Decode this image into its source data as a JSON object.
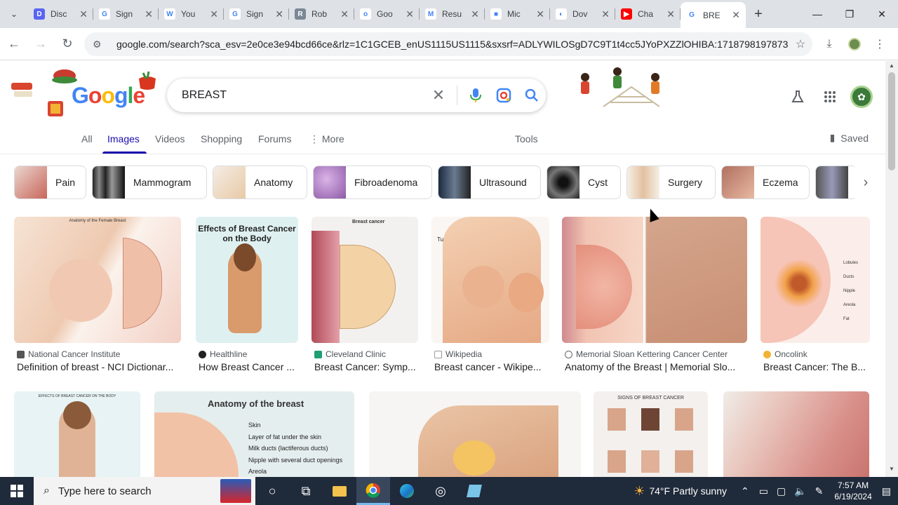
{
  "browser": {
    "tabs": [
      {
        "title": "Disc",
        "color": "#5865f2",
        "glyph": "D"
      },
      {
        "title": "Sign",
        "color": "#ffffff",
        "glyph": "G"
      },
      {
        "title": "You",
        "color": "#ffffff",
        "glyph": "W"
      },
      {
        "title": "Sign",
        "color": "#ffffff",
        "glyph": "G"
      },
      {
        "title": "Rob",
        "color": "#7a8796",
        "glyph": "R"
      },
      {
        "title": "Goo",
        "color": "#ffffff",
        "glyph": "o"
      },
      {
        "title": "Resu",
        "color": "#ffffff",
        "glyph": "M"
      },
      {
        "title": "Mic",
        "color": "#ffffff",
        "glyph": "■"
      },
      {
        "title": "Dov",
        "color": "#ffffff",
        "glyph": "◐"
      },
      {
        "title": "Cha",
        "color": "#ff0000",
        "glyph": "▶"
      },
      {
        "title": "BRE",
        "color": "#ffffff",
        "glyph": "G"
      }
    ],
    "url": "google.com/search?sca_esv=2e0ce3e94bcd66ce&rlz=1C1GCEB_enUS1115US1115&sxsrf=ADLYWILOSgD7C9T1t4cc5JYoPXZZlOHIBA:1718798197873&q=B..."
  },
  "search": {
    "query": "BREAST",
    "tabs": [
      "All",
      "Images",
      "Videos",
      "Shopping",
      "Forums",
      "More"
    ],
    "tools_label": "Tools",
    "saved_label": "Saved"
  },
  "chips": [
    "Pain",
    "Mammogram",
    "Anatomy",
    "Fibroadenoma",
    "Ultrasound",
    "Cyst",
    "Surgery",
    "Eczema"
  ],
  "results_row1": [
    {
      "source": "National Cancer Institute",
      "title": "Definition of breast - NCI Dictionar...",
      "img_caption": "Anatomy of the Female Breast"
    },
    {
      "source": "Healthline",
      "title": "How Breast Cancer ...",
      "img_caption": "Effects of Breast Cancer on the Body"
    },
    {
      "source": "Cleveland Clinic",
      "title": "Breast Cancer: Symp...",
      "img_caption": "Breast cancer"
    },
    {
      "source": "Wikipedia",
      "title": "Breast cancer - Wikipe...",
      "img_caption": "Tumor"
    },
    {
      "source": "Memorial Sloan Kettering Cancer Center",
      "title": "Anatomy of the Breast | Memorial Slo...",
      "img_caption": ""
    },
    {
      "source": "Oncolink",
      "title": "Breast Cancer: The B...",
      "img_caption": ""
    }
  ],
  "oncolink_labels": [
    "Lobules",
    "Ducts",
    "Nipple",
    "Areola",
    "Fat"
  ],
  "row2": {
    "img1_caption": "EFFECTS OF BREAST CANCER ON THE BODY",
    "img2_caption": "Anatomy of the breast",
    "img2_labels": [
      "Skin",
      "Layer of fat under the skin",
      "Milk ducts (lactiferous ducts)",
      "Nipple with several duct openings",
      "Areola"
    ],
    "img4_caption": "SIGNS OF BREAST CANCER"
  },
  "taskbar": {
    "search_placeholder": "Type here to search",
    "weather_temp": "74°F",
    "weather_text": "Partly sunny",
    "time": "7:57 AM",
    "date": "6/19/2024"
  }
}
